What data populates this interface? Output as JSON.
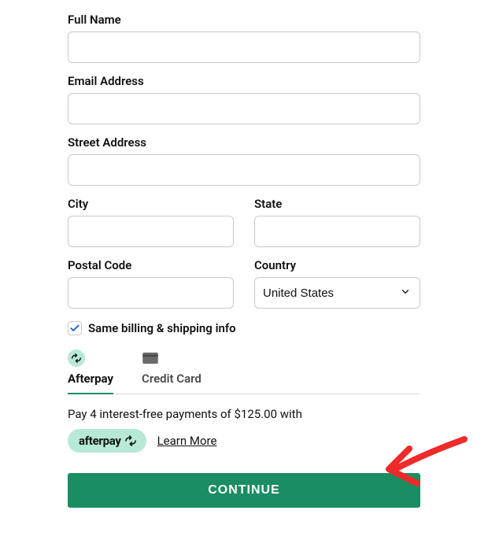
{
  "fields": {
    "full_name_label": "Full Name",
    "full_name_value": "",
    "email_label": "Email Address",
    "email_value": "",
    "street_label": "Street Address",
    "street_value": "",
    "city_label": "City",
    "city_value": "",
    "state_label": "State",
    "state_value": "",
    "postal_label": "Postal Code",
    "postal_value": "",
    "country_label": "Country",
    "country_value": "United States"
  },
  "checkbox": {
    "same_billing_label": "Same billing & shipping info",
    "checked": true
  },
  "tabs": {
    "afterpay_label": "Afterpay",
    "credit_card_label": "Credit Card"
  },
  "afterpay": {
    "message": "Pay 4 interest-free payments of $125.00 with",
    "badge_text": "afterpay",
    "learn_more": "Learn More"
  },
  "continue_label": "CONTINUE",
  "colors": {
    "accent": "#1a8d63",
    "mint": "#b7e9d6",
    "border": "#c9c9c9"
  }
}
